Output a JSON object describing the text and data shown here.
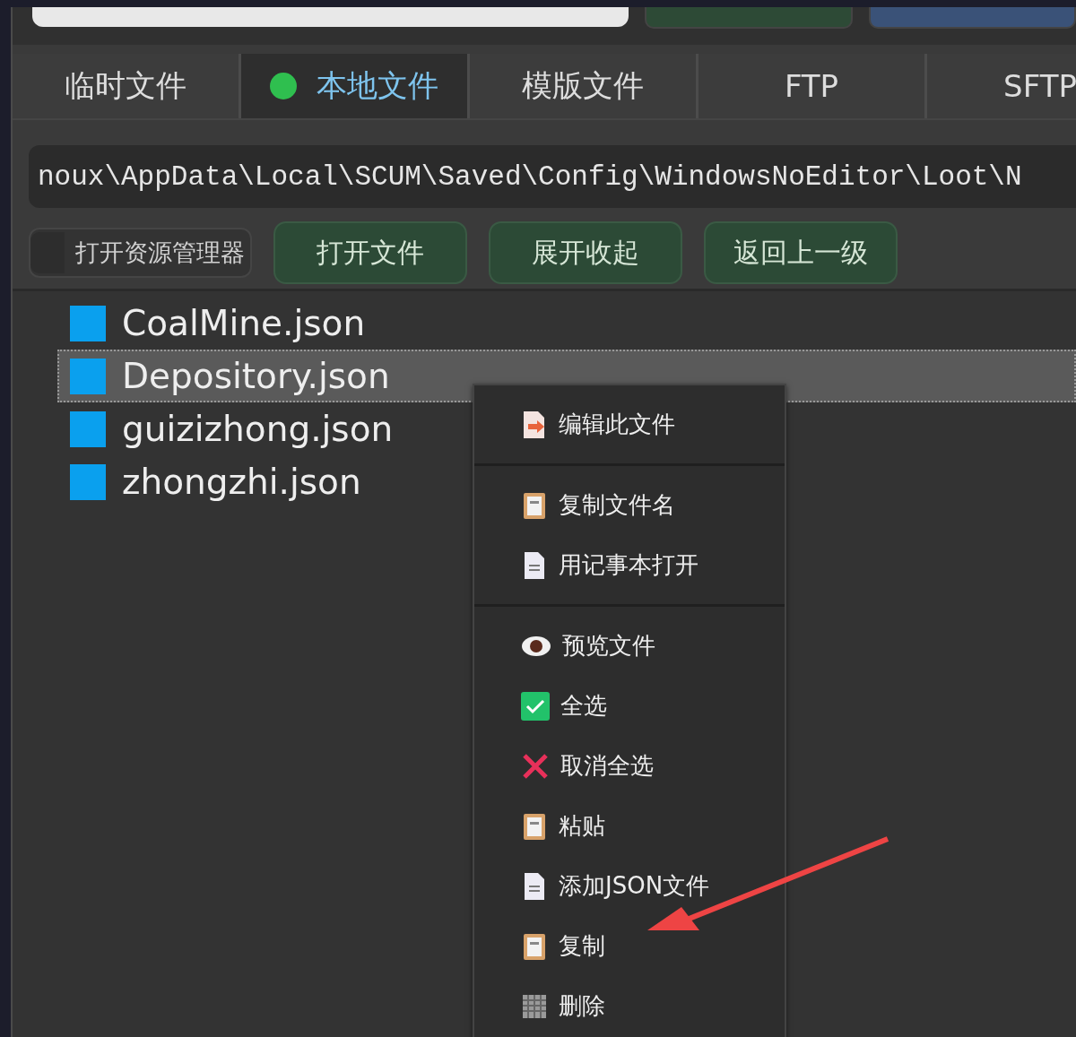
{
  "top_bar": {
    "buttons": [
      {
        "kind": "green"
      },
      {
        "kind": "blue"
      }
    ]
  },
  "tabs": [
    {
      "label": "临时文件",
      "selected": false
    },
    {
      "label": "本地文件",
      "selected": true
    },
    {
      "label": "模版文件",
      "selected": false
    },
    {
      "label": "FTP",
      "selected": false
    },
    {
      "label": "SFTP",
      "selected": false
    }
  ],
  "path": {
    "value": "noux\\AppData\\Local\\SCUM\\Saved\\Config\\WindowsNoEditor\\Loot\\N"
  },
  "toolbar": {
    "explorer_checkbox": {
      "label": "打开资源管理器",
      "checked": false
    },
    "buttons": [
      "打开文件",
      "展开收起",
      "返回上一级"
    ]
  },
  "files": [
    {
      "name": "CoalMine.json",
      "selected": false
    },
    {
      "name": "Depository.json",
      "selected": true
    },
    {
      "name": "guizizhong.json",
      "selected": false
    },
    {
      "name": "zhongzhi.json",
      "selected": false
    }
  ],
  "context_menu": {
    "sections": [
      [
        {
          "label": "编辑此文件",
          "kind": "edit"
        }
      ],
      [
        {
          "label": "复制文件名",
          "kind": "clipboard"
        },
        {
          "label": "用记事本打开",
          "kind": "document"
        }
      ],
      [
        {
          "label": "预览文件",
          "kind": "eye"
        },
        {
          "label": "全选",
          "kind": "check"
        },
        {
          "label": "取消全选",
          "kind": "cross"
        },
        {
          "label": "粘贴",
          "kind": "clipboard"
        },
        {
          "label": "添加JSON文件",
          "kind": "document"
        },
        {
          "label": "复制",
          "kind": "clipboard"
        },
        {
          "label": "删除",
          "kind": "trash"
        }
      ]
    ]
  }
}
